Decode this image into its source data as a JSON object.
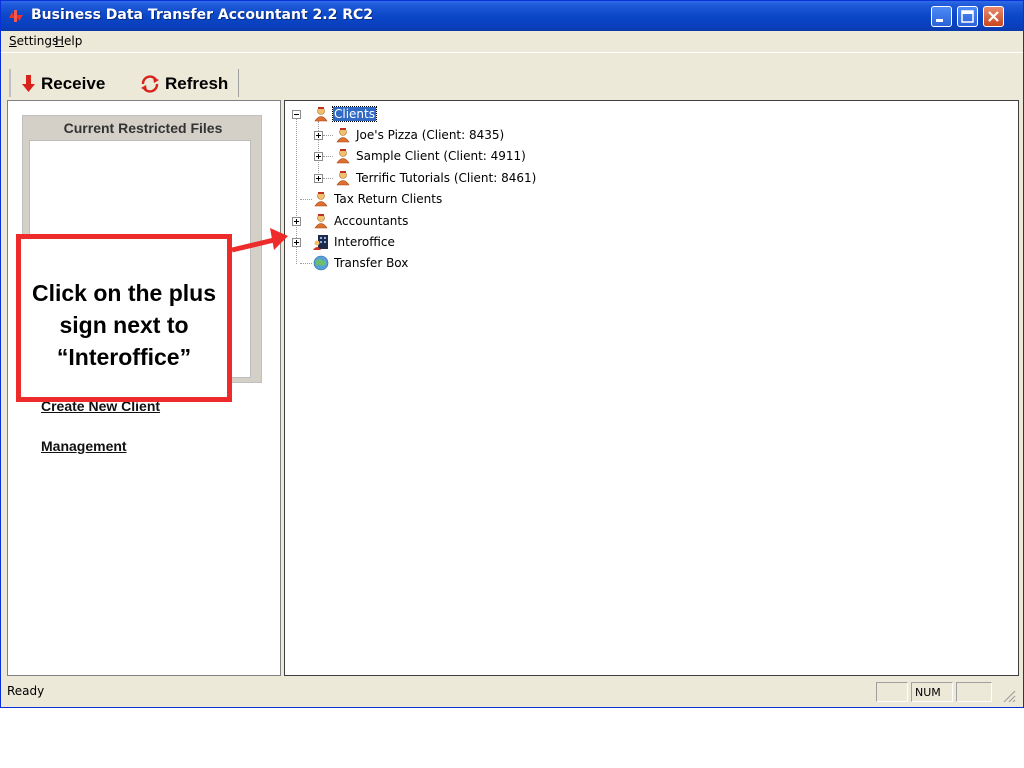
{
  "window": {
    "title": "Business Data Transfer Accountant 2.2 RC2"
  },
  "menu": {
    "settings": "Settings",
    "help": "Help"
  },
  "toolbar": {
    "receive": "Receive",
    "refresh": "Refresh"
  },
  "left_pane": {
    "restricted_title": "Current Restricted Files",
    "links": {
      "create_client": "Create New Client",
      "management": "Management"
    }
  },
  "tree": {
    "clients": "Clients",
    "joes_pizza": "Joe's Pizza (Client: 8435)",
    "sample_client": "Sample Client (Client: 4911)",
    "terrific": "Terrific Tutorials (Client: 8461)",
    "tax_return": "Tax Return Clients",
    "accountants": "Accountants",
    "interoffice": "Interoffice",
    "transfer_box": "Transfer Box"
  },
  "status": {
    "text": "Ready",
    "num": "NUM"
  },
  "callout": {
    "text": "Click on the plus sign next to “Interoffice”"
  },
  "colors": {
    "titlebar": "#0a47c8",
    "callout_border": "#ee2b2b",
    "selection": "#316ac5"
  }
}
